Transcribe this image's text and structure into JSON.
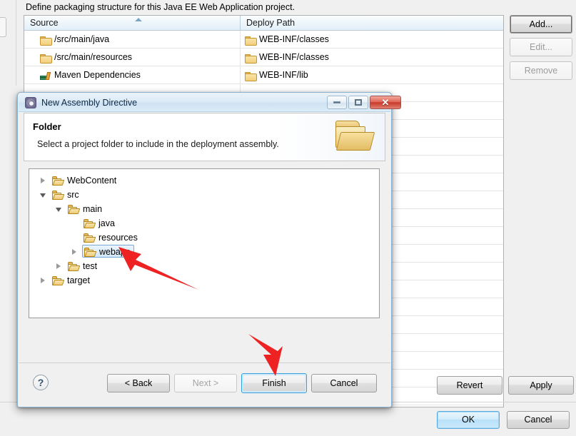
{
  "background": {
    "description": "Define packaging structure for this Java EE Web Application project.",
    "table": {
      "columns": [
        "Source",
        "Deploy Path"
      ],
      "sort_column": "Source",
      "sort_direction": "ascending",
      "rows": [
        {
          "source": "/src/main/java",
          "source_icon": "folder-icon",
          "deploy": "WEB-INF/classes",
          "deploy_icon": "folder-icon"
        },
        {
          "source": "/src/main/resources",
          "source_icon": "folder-icon",
          "deploy": "WEB-INF/classes",
          "deploy_icon": "folder-icon"
        },
        {
          "source": "Maven Dependencies",
          "source_icon": "library-books-icon",
          "deploy": "WEB-INF/lib",
          "deploy_icon": "folder-icon"
        }
      ]
    },
    "side_buttons": [
      {
        "label": "Add...",
        "mnemonic": "d",
        "enabled": true,
        "is_default": true
      },
      {
        "label": "Edit...",
        "mnemonic": "E",
        "enabled": false,
        "is_default": false
      },
      {
        "label": "Remove",
        "mnemonic": "R",
        "enabled": false,
        "is_default": false
      }
    ],
    "footer_buttons": [
      {
        "label": "Revert",
        "enabled": true
      },
      {
        "label": "Apply",
        "enabled": true
      }
    ],
    "dialog_buttons": [
      {
        "label": "OK",
        "enabled": true,
        "is_default": true
      },
      {
        "label": "Cancel",
        "enabled": true
      }
    ]
  },
  "dialog": {
    "title": "New Assembly Directive",
    "icon": "eclipse-wizard-icon",
    "window_controls": {
      "minimize": "minimize-icon",
      "maximize": "maximize-icon",
      "close": "close-icon"
    },
    "header": {
      "title": "Folder",
      "subtitle": "Select a project folder to include in the deployment assembly.",
      "icon": "open-folder-icon"
    },
    "tree": [
      {
        "label": "WebContent",
        "depth": 0,
        "state": "collapsed",
        "selected": false
      },
      {
        "label": "src",
        "depth": 0,
        "state": "expanded",
        "selected": false
      },
      {
        "label": "main",
        "depth": 1,
        "state": "expanded",
        "selected": false
      },
      {
        "label": "java",
        "depth": 2,
        "state": "leaf",
        "selected": false
      },
      {
        "label": "resources",
        "depth": 2,
        "state": "leaf",
        "selected": false
      },
      {
        "label": "webapp",
        "depth": 2,
        "state": "collapsed",
        "selected": true
      },
      {
        "label": "test",
        "depth": 1,
        "state": "collapsed",
        "selected": false
      },
      {
        "label": "target",
        "depth": 0,
        "state": "collapsed",
        "selected": false
      }
    ],
    "help_glyph": "?",
    "buttons": [
      {
        "label": "< Back",
        "enabled": true,
        "is_default": false
      },
      {
        "label": "Next >",
        "enabled": false,
        "is_default": false
      },
      {
        "label": "Finish",
        "enabled": true,
        "is_default": true
      },
      {
        "label": "Cancel",
        "enabled": true,
        "is_default": false
      }
    ]
  },
  "annotations": {
    "color": "#ee2222",
    "arrows": [
      {
        "name": "arrow-to-webapp",
        "points_at": "webapp"
      },
      {
        "name": "arrow-to-finish",
        "points_at": "Finish"
      }
    ]
  }
}
